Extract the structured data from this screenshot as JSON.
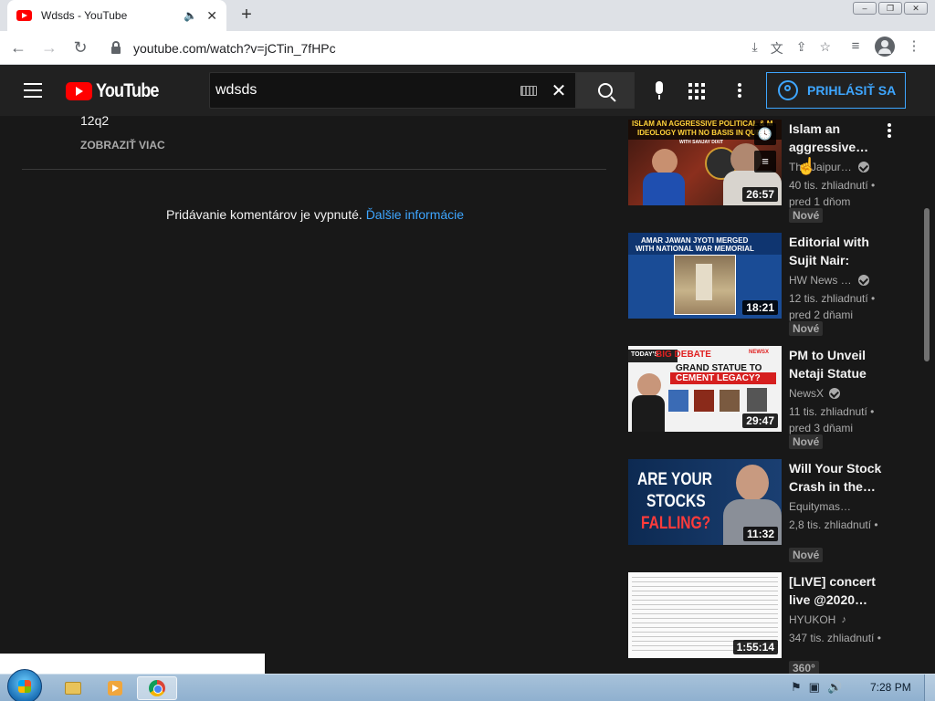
{
  "browser": {
    "tab_title": "Wdsds - YouTube",
    "url": "youtube.com/watch?v=jCTin_7fHPc"
  },
  "masthead": {
    "logo_text": "YouTube",
    "search_value": "wdsds",
    "signin_label": "PRIHLÁSIŤ SA"
  },
  "main": {
    "description_tail": "12q2",
    "show_more": "ZOBRAZIŤ VIAC",
    "comments_off_text": "Pridávanie komentárov je vypnuté.",
    "comments_off_link": "Ďalšie informácie"
  },
  "recommendations": [
    {
      "title": "Islam an aggressive…",
      "channel": "The Jaipur …",
      "verified": true,
      "views": "40 tis. zhliadnutí •",
      "age": "pred 1 dňom",
      "badge": "Nové",
      "duration": "26:57",
      "thumb_text": [
        "ISLAM AN AGGRESSIVE POLITICAL & M",
        "IDEOLOGY WITH NO BASIS IN QUR",
        "WITH SANJAY DIXIT"
      ]
    },
    {
      "title": "Editorial with Sujit Nair: Am…",
      "channel": "HW News E…",
      "verified": true,
      "views": "12 tis. zhliadnutí •",
      "age": "pred 2 dňami",
      "badge": "Nové",
      "duration": "18:21",
      "thumb_text": [
        "AMAR JAWAN JYOTI MERGED",
        "WITH NATIONAL WAR MEMORIAL"
      ]
    },
    {
      "title": "PM to Unveil Netaji Statue …",
      "channel": "NewsX",
      "verified": true,
      "views": "11 tis. zhliadnutí •",
      "age": "pred 3 dňami",
      "badge": "Nové",
      "duration": "29:47",
      "thumb_text": [
        "TODAY'S",
        "BIG DEBATE",
        "GRAND STATUE TO",
        "CEMENT LEGACY?",
        "NEWSX"
      ]
    },
    {
      "title": "Will Your Stock Crash in the…",
      "channel": "Equitymaster",
      "verified": false,
      "views": "2,8 tis. zhliadnutí •",
      "age": "",
      "badge": "Nové",
      "duration": "11:32",
      "thumb_text": [
        "ARE YOUR",
        "STOCKS",
        "FALLING?"
      ]
    },
    {
      "title": "[LIVE] concert live @2020…",
      "channel": "HYUKOH",
      "verified": false,
      "music": true,
      "views": "347 tis. zhliadnutí •",
      "age": "",
      "badge": "360°",
      "duration": "1:55:14",
      "thumb_text": []
    }
  ],
  "taskbar": {
    "clock": "7:28 PM"
  },
  "icons": {
    "tab_audio": "🔈",
    "tab_close": "✕",
    "new_tab": "+",
    "back": "←",
    "forward": "→",
    "reload": "↻",
    "install": "⤓",
    "translate": "文",
    "share": "⇪",
    "bookmark": "☆",
    "media_control": "≡",
    "menu": "⋮",
    "clear": "✕",
    "watch_later": "🕓",
    "add_queue": "≡",
    "music_note": "♪",
    "tray_flag": "⚑",
    "tray_network": "▣",
    "tray_volume": "🔊",
    "cursor": "☝"
  }
}
